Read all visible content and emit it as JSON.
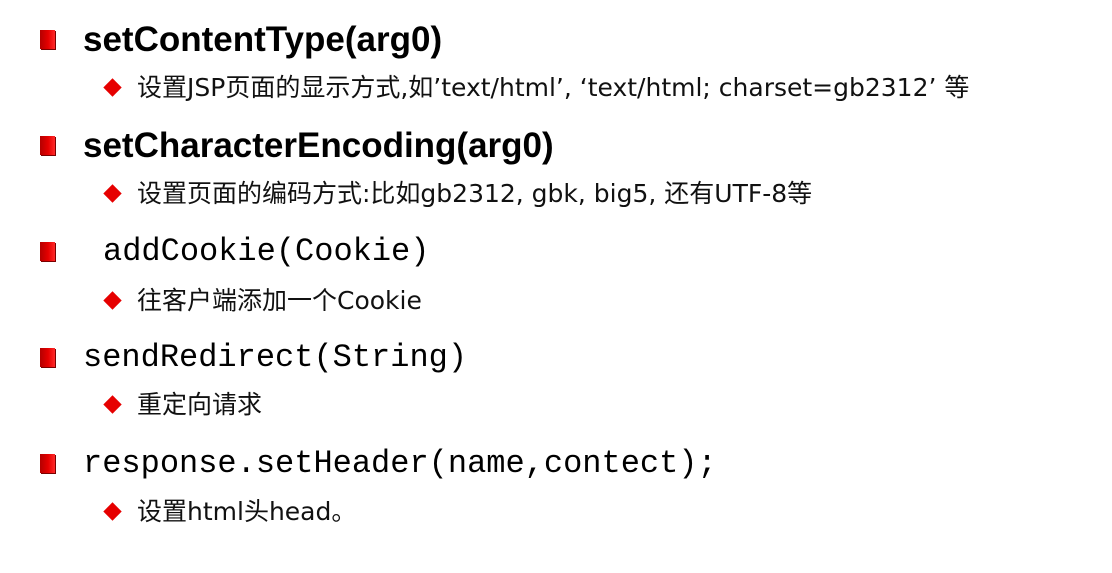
{
  "items": [
    {
      "title": "setContentType(arg0)",
      "description": "设置JSP页面的显示方式,如’text/html’, ‘text/html; charset=gb2312’ 等"
    },
    {
      "title": "setCharacterEncoding(arg0)",
      "description": "设置页面的编码方式:比如gb2312, gbk, big5, 还有UTF-8等"
    },
    {
      "title": "addCookie(Cookie)",
      "description": "往客户端添加一个Cookie"
    },
    {
      "title": "sendRedirect(String)",
      "description": "重定向请求"
    },
    {
      "title": "response.setHeader(name,contect);",
      "description": "设置html头head。"
    }
  ],
  "colors": {
    "bullet": "#e60000",
    "text": "#000000",
    "background": "#ffffff"
  },
  "icons": {
    "level1_bullet": "square-bullet-icon",
    "level2_bullet": "diamond-bullet-icon"
  }
}
